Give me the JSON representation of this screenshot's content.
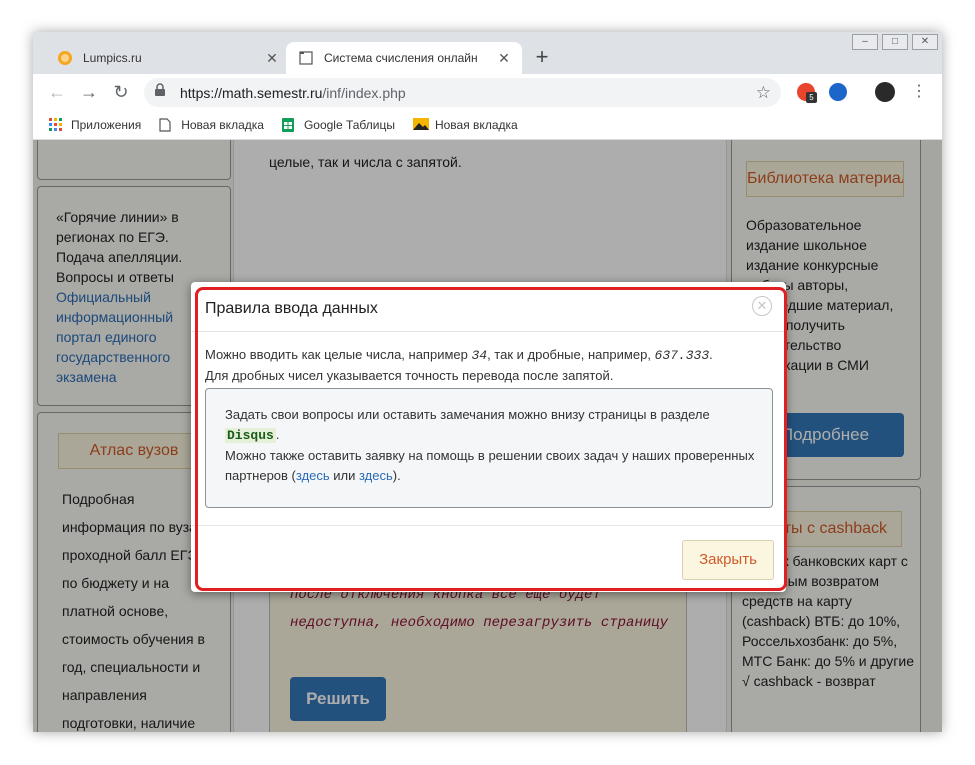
{
  "browser": {
    "tabs": [
      {
        "title": "Lumpics.ru",
        "active": false
      },
      {
        "title": "Система счисления онлайн",
        "active": true
      }
    ],
    "url_host": "https://math.semestr.ru",
    "url_path": "/inf/index.php",
    "window_controls": [
      "–",
      "□",
      "✕"
    ],
    "ext_badge": "5",
    "bookmarks": [
      {
        "label": "Приложения",
        "icon": "apps-grid-icon"
      },
      {
        "label": "Новая вкладка",
        "icon": "page-icon"
      },
      {
        "label": "Google Таблицы",
        "icon": "sheets-icon"
      },
      {
        "label": "Новая вкладка",
        "icon": "image-icon"
      }
    ]
  },
  "page": {
    "left": {
      "hotlines_text": "«Горячие линии» в регионах по ЕГЭ. Подача апелляции. Вопросы и ответы",
      "hotlines_link": "Официальный информационный портал единого государственного экзамена",
      "atlas_header": "Атлас вузов",
      "atlas_text": "Подробная информация по вузам: проходной балл ЕГЭ по бюджету и на платной основе, стоимость обучения в год, специальности и направления подготовки, наличие"
    },
    "mid": {
      "top_text": "целые, так и числа с запятой.",
      "adblock_note": "Для получения решения необходимо отключить блокираторы типа AdBlock (Adguard, AdFender, AdMuncher, DrWeb, Kaspersky, Avast). Если после отключения кнопка все еще будет недоступна, необходимо перезагрузить страницу",
      "solve_button": "Решить"
    },
    "right": {
      "library_header": "Библиотека материалов",
      "library_text": "Образовательное издание школьное издание конкурсные работы авторы, прошедшие материал, могут получить свидетельство публикации в СМИ",
      "more_button": "Подробнее",
      "cashback_header": "Карты с cashback",
      "cashback_text": "Список банковских карт с выгодным возвратом средств на карту (cashback) ВТБ: до 10%, Россельхозбанк: до 5%, МТС Банк: до 5% и другие √ cashback - возврат"
    }
  },
  "modal": {
    "title": "Правила ввода данных",
    "close_icon": "✕",
    "line1_a": "Можно вводить как целые числа, например ",
    "line1_ex1": "34",
    "line1_b": ", так и дробные, например, ",
    "line1_ex2": "637.333",
    "line1_c": ".",
    "line2": "Для дробных чисел указывается точность перевода после запятой.",
    "info_a": "Задать свои вопросы или оставить замечания можно внизу страницы в разделе ",
    "info_code": "Disqus",
    "info_b": ".",
    "info_c": "Можно также оставить заявку на помощь в решении своих задач у наших проверенных партнеров (",
    "info_link1": "здесь",
    "info_d": " или ",
    "info_link2": "здесь",
    "info_e": ").",
    "close_button": "Закрыть"
  },
  "colors": {
    "highlight": "#e02020",
    "accent": "#d05b2a",
    "link": "#2b6cb5"
  }
}
